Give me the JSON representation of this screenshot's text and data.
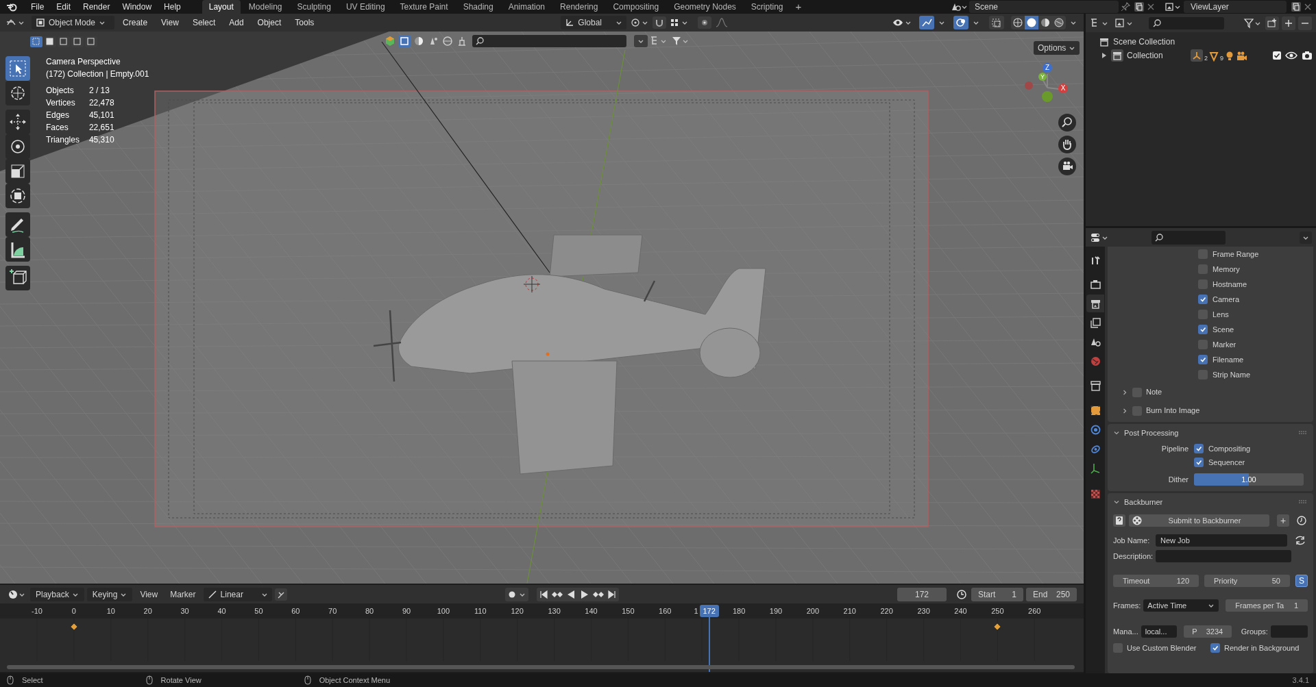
{
  "top_bar": {
    "menus": [
      "File",
      "Edit",
      "Render",
      "Window",
      "Help"
    ],
    "workspaces": [
      {
        "label": "Layout",
        "selected": true
      },
      {
        "label": "Modeling",
        "selected": false
      },
      {
        "label": "Sculpting",
        "selected": false
      },
      {
        "label": "UV Editing",
        "selected": false
      },
      {
        "label": "Texture Paint",
        "selected": false
      },
      {
        "label": "Shading",
        "selected": false
      },
      {
        "label": "Animation",
        "selected": false
      },
      {
        "label": "Rendering",
        "selected": false
      },
      {
        "label": "Compositing",
        "selected": false
      },
      {
        "label": "Geometry Nodes",
        "selected": false
      },
      {
        "label": "Scripting",
        "selected": false
      }
    ],
    "add_workspace": "+",
    "scene": "Scene",
    "view_layer": "ViewLayer"
  },
  "viewport_header": {
    "mode": "Object Mode",
    "menus": [
      "Create",
      "View",
      "Select",
      "Add",
      "Object",
      "Tools"
    ],
    "orientation": "Global",
    "options": "Options"
  },
  "toolbar": [
    {
      "kind": "select",
      "selected": true
    },
    {
      "kind": "cursor",
      "selected": false
    },
    {
      "kind": "move",
      "selected": false
    },
    {
      "kind": "rotate",
      "selected": false
    },
    {
      "kind": "scale",
      "selected": false
    },
    {
      "kind": "transform",
      "selected": false
    },
    {
      "kind": "annotate",
      "selected": false
    },
    {
      "kind": "measure",
      "selected": false
    },
    {
      "kind": "add-cube",
      "selected": false
    }
  ],
  "viewport": {
    "title": "Camera Perspective",
    "context": "(172) Collection | Empty.001",
    "stats": [
      {
        "label": "Objects",
        "value": "2 / 13"
      },
      {
        "label": "Vertices",
        "value": "22,478"
      },
      {
        "label": "Edges",
        "value": "45,101"
      },
      {
        "label": "Faces",
        "value": "22,651"
      },
      {
        "label": "Triangles",
        "value": "45,310"
      }
    ],
    "axes": {
      "z": "Z",
      "y": "Y",
      "x": "X"
    }
  },
  "outliner": {
    "root": "Scene Collection",
    "collection": {
      "label": "Collection",
      "expanded": false,
      "counts": [
        "2",
        "9"
      ]
    }
  },
  "properties": {
    "tabs": [
      {
        "kind": "tool",
        "selected": false
      },
      {
        "kind": "render",
        "selected": false
      },
      {
        "kind": "output",
        "selected": true
      },
      {
        "kind": "view-layer",
        "selected": false
      },
      {
        "kind": "scene",
        "selected": false
      },
      {
        "kind": "world",
        "selected": false
      },
      {
        "kind": "collection",
        "selected": false
      },
      {
        "kind": "object",
        "selected": false
      },
      {
        "kind": "physics",
        "selected": false
      },
      {
        "kind": "constraints",
        "selected": false
      },
      {
        "kind": "data",
        "selected": false
      },
      {
        "kind": "texture",
        "selected": false
      }
    ],
    "metadata": [
      {
        "label": "Frame Range",
        "checked": false
      },
      {
        "label": "Memory",
        "checked": false
      },
      {
        "label": "Hostname",
        "checked": false
      },
      {
        "label": "Camera",
        "checked": true
      },
      {
        "label": "Lens",
        "checked": false
      },
      {
        "label": "Scene",
        "checked": true
      },
      {
        "label": "Marker",
        "checked": false
      },
      {
        "label": "Filename",
        "checked": true
      },
      {
        "label": "Strip Name",
        "checked": false
      }
    ],
    "subpanels": [
      {
        "label": "Note",
        "checked": false,
        "expanded": false
      },
      {
        "label": "Burn Into Image",
        "checked": false,
        "expanded": false
      }
    ],
    "post_processing": {
      "title": "Post Processing",
      "expanded": true,
      "pipeline_label": "Pipeline",
      "pipeline": [
        {
          "label": "Compositing",
          "checked": true
        },
        {
          "label": "Sequencer",
          "checked": true
        }
      ],
      "dither_label": "Dither",
      "dither": {
        "value": "1.00",
        "level": 0.5
      }
    },
    "backburner": {
      "title": "Backburner",
      "expanded": true,
      "submit": "Submit to Backburner",
      "add": "+",
      "job_name_label": "Job Name:",
      "job_name": "New Job",
      "description_label": "Description:",
      "timeout_label": "Timeout",
      "timeout": "120",
      "priority_label": "Priority",
      "priority": "50",
      "s_toggle": "S",
      "frames_label": "Frames:",
      "frames": "Active Time",
      "frames_per_task_label": "Frames per Ta",
      "frames_per_task": "1",
      "manager_label": "Mana...",
      "manager": "local...",
      "port_label": "P",
      "port": "3234",
      "groups_label": "Groups:",
      "use_custom_blender": {
        "label": "Use Custom Blender",
        "checked": false
      },
      "render_in_background": {
        "label": "Render in Background",
        "checked": true
      }
    }
  },
  "timeline": {
    "menus": [
      "Playback",
      "Keying",
      "View",
      "Marker"
    ],
    "interpolation": "Linear",
    "current_frame": "172",
    "start_label": "Start",
    "start": "1",
    "end_label": "End",
    "end": "250",
    "ruler": [
      "-10",
      "0",
      "10",
      "20",
      "30",
      "40",
      "50",
      "60",
      "70",
      "80",
      "90",
      "100",
      "110",
      "120",
      "130",
      "140",
      "150",
      "160",
      "1",
      "180",
      "190",
      "200",
      "210",
      "220",
      "230",
      "240",
      "250",
      "260"
    ],
    "playhead": {
      "label": "172",
      "level": 0.674
    }
  },
  "status_bar": {
    "hints": [
      "Select",
      "Rotate View",
      "Object Context Menu"
    ],
    "version": "3.4.1"
  }
}
